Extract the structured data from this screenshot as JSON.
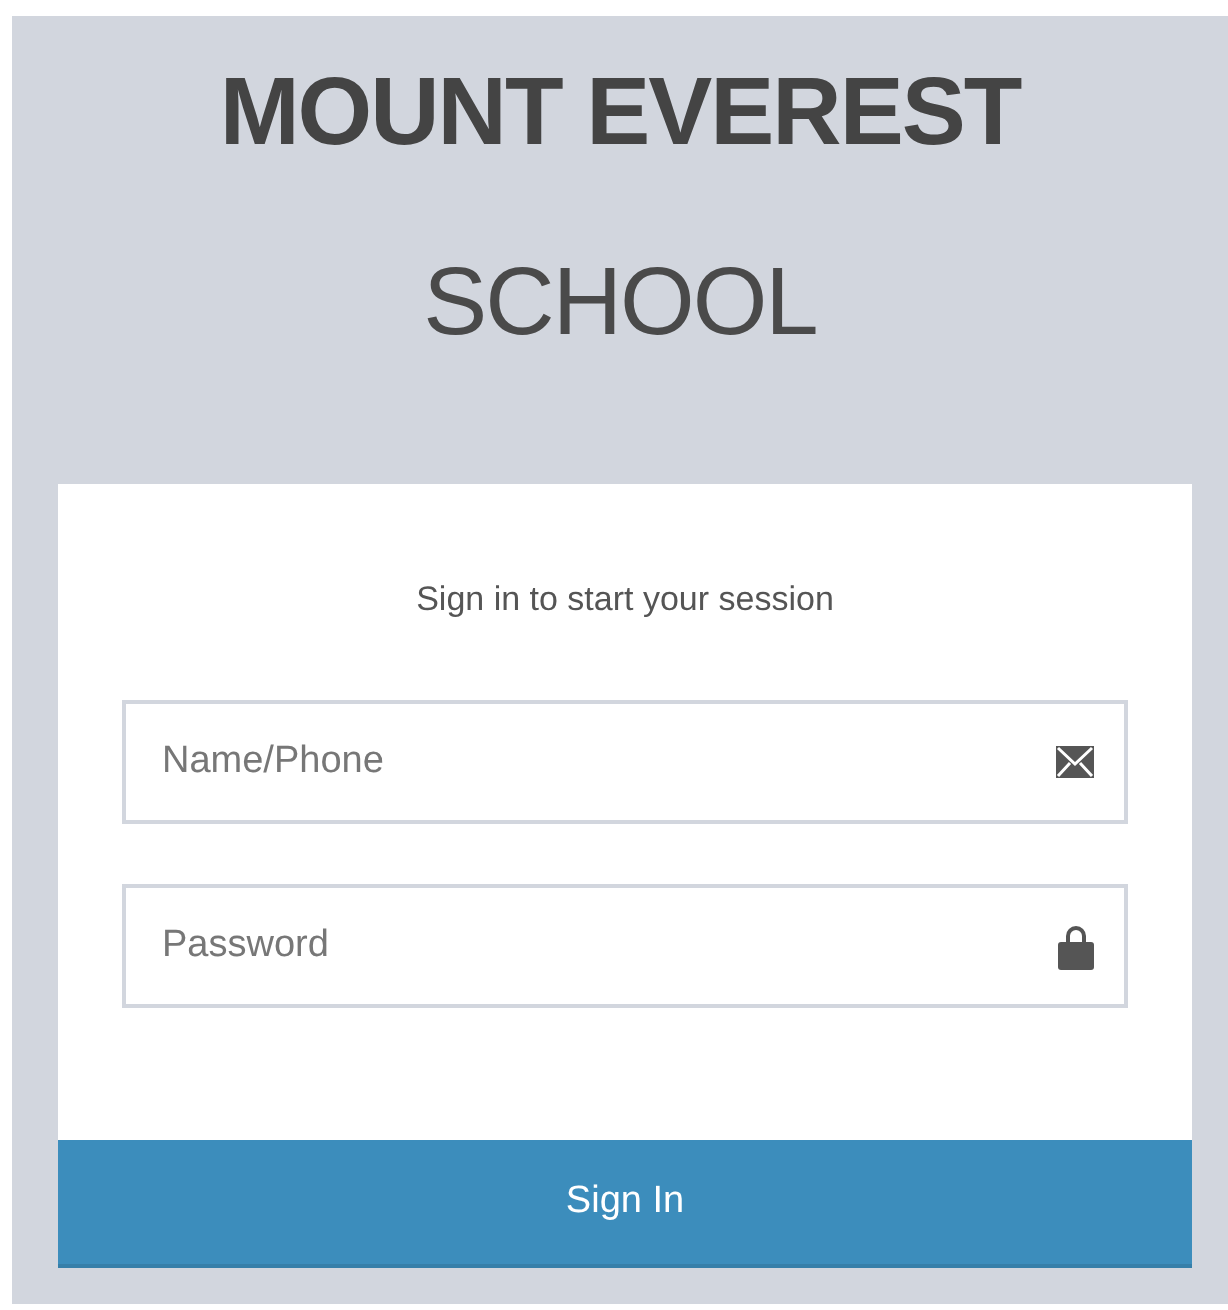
{
  "logo": {
    "title": "MOUNT EVEREST",
    "subtitle": "SCHOOL"
  },
  "login_box": {
    "message": "Sign in to start your session",
    "fields": [
      {
        "kind": "email",
        "placeholder": "Name/Phone"
      },
      {
        "kind": "password",
        "placeholder": "Password"
      }
    ],
    "button": "Sign In"
  }
}
